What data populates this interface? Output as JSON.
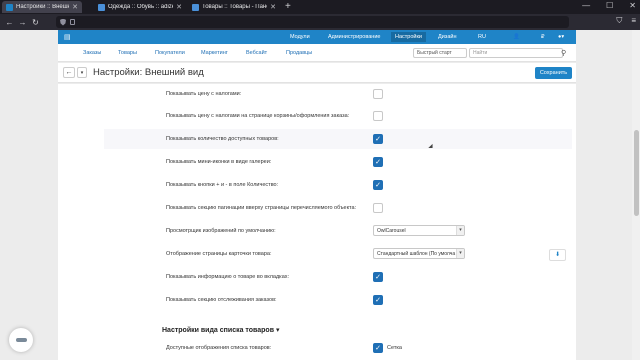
{
  "browser": {
    "tabs": [
      {
        "label": "Настройки :: Внешний вид",
        "active": true,
        "icon_color": "#1f84c7"
      },
      {
        "label": "Одежда :: Обувь :: adizero Ru",
        "active": false,
        "icon_color": "#4a90d9"
      },
      {
        "label": "Товары :: Товары - Панель ад",
        "active": false,
        "icon_color": "#4a90d9"
      }
    ],
    "new_tab": "+",
    "window_controls": [
      "—",
      "☐",
      "✕"
    ]
  },
  "admin": {
    "top_menu": [
      "Модули",
      "Администрирование",
      "Настройки",
      "Дизайн",
      "RU",
      "₽"
    ],
    "main_menu": [
      "Заказы",
      "Товары",
      "Покупатели",
      "Маркетинг",
      "Вебсайт",
      "Продавцы"
    ],
    "quick_start": "Быстрый старт",
    "search_placeholder": "Найти",
    "page_title": "Настройки: Внешний вид",
    "save_label": "Сохранить"
  },
  "settings": [
    {
      "label": "Показывать цену с налогами:",
      "type": "checkbox",
      "checked": false
    },
    {
      "label": "Показывать цену с налогами на странице корзины/оформления заказа:",
      "type": "checkbox",
      "checked": false
    },
    {
      "label": "Показывать количество доступных товаров:",
      "type": "checkbox",
      "checked": true
    },
    {
      "label": "Показывать мини-иконки в виде галереи:",
      "type": "checkbox",
      "checked": true
    },
    {
      "label": "Показывать кнопки + и - в поле Количество:",
      "type": "checkbox",
      "checked": true
    },
    {
      "label": "Показывать секцию пагинации вверху страницы перечисляемого объекта:",
      "type": "checkbox",
      "checked": false
    },
    {
      "label": "Просмотрщик изображений по умолчанию:",
      "type": "select",
      "value": "OwlCarousel"
    },
    {
      "label": "Отображение страницы карточки товара:",
      "type": "select",
      "value": "Стандартный шаблон (По умолча"
    },
    {
      "label": "Показывать информацию о товаре во вкладках:",
      "type": "checkbox",
      "checked": true
    },
    {
      "label": "Показывать секцию отслеживания заказов:",
      "type": "checkbox",
      "checked": true
    }
  ],
  "section": {
    "title": "Настройки вида списка товаров",
    "first_item_label": "Доступные отображения списка товаров:",
    "first_item_value": "Сетка"
  }
}
